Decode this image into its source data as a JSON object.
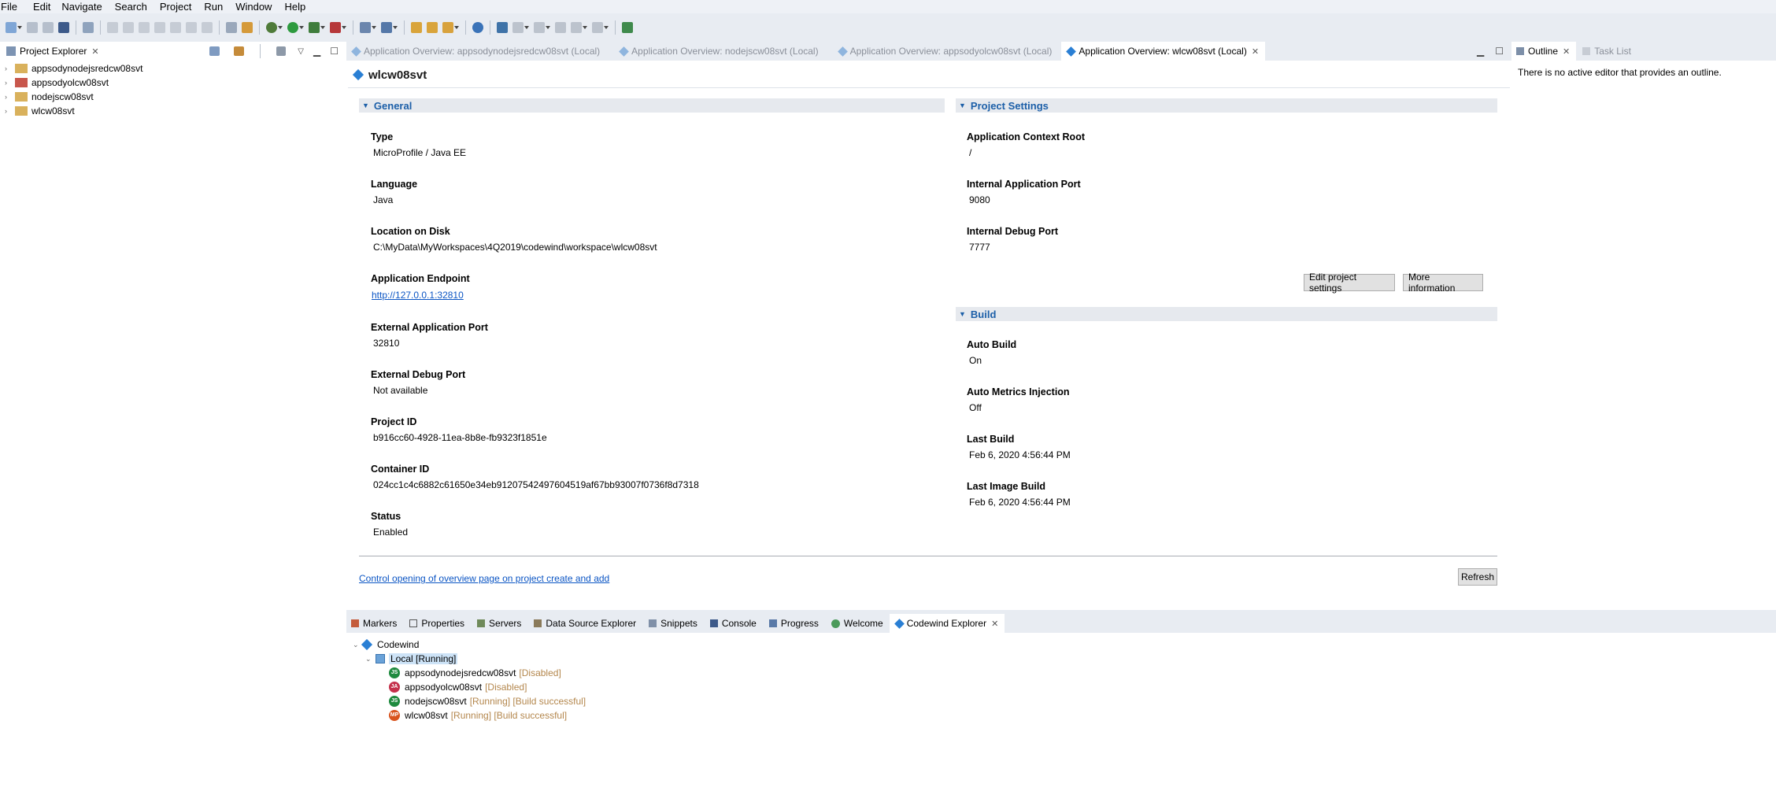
{
  "menu": [
    "File",
    "Edit",
    "Navigate",
    "Search",
    "Project",
    "Run",
    "Window",
    "Help"
  ],
  "project_explorer": {
    "title": "Project Explorer",
    "items": [
      "appsodynodejsredcw08svt",
      "appsodyolcw08svt",
      "nodejscw08svt",
      "wlcw08svt"
    ]
  },
  "editor_tabs": [
    {
      "label": "Application Overview: appsodynodejsredcw08svt (Local)",
      "active": false
    },
    {
      "label": "Application Overview: nodejscw08svt (Local)",
      "active": false
    },
    {
      "label": "Application Overview: appsodyolcw08svt (Local)",
      "active": false
    },
    {
      "label": "Application Overview: wlcw08svt (Local)",
      "active": true
    }
  ],
  "overview": {
    "title": "wlcw08svt",
    "general": {
      "header": "General",
      "fields": [
        {
          "label": "Type",
          "value": "MicroProfile / Java EE"
        },
        {
          "label": "Language",
          "value": "Java"
        },
        {
          "label": "Location on Disk",
          "value": "C:\\MyData\\MyWorkspaces\\4Q2019\\codewind\\workspace\\wlcw08svt"
        },
        {
          "label": "Application Endpoint",
          "value": "http://127.0.0.1:32810"
        },
        {
          "label": "External Application Port",
          "value": "32810"
        },
        {
          "label": "External Debug Port",
          "value": "Not available"
        },
        {
          "label": "Project ID",
          "value": "b916cc60-4928-11ea-8b8e-fb9323f1851e"
        },
        {
          "label": "Container ID",
          "value": "024cc1c4c6882c61650e34eb91207542497604519af67bb93007f0736f8d7318"
        },
        {
          "label": "Status",
          "value": "Enabled"
        }
      ]
    },
    "project_settings": {
      "header": "Project Settings",
      "fields": [
        {
          "label": "Application Context Root",
          "value": "/"
        },
        {
          "label": "Internal Application Port",
          "value": "9080"
        },
        {
          "label": "Internal Debug Port",
          "value": "7777"
        }
      ],
      "edit_button": "Edit project settings",
      "more_button": "More information"
    },
    "build": {
      "header": "Build",
      "fields": [
        {
          "label": "Auto Build",
          "value": "On"
        },
        {
          "label": "Auto Metrics Injection",
          "value": "Off"
        },
        {
          "label": "Last Build",
          "value": "Feb 6, 2020 4:56:44 PM"
        },
        {
          "label": "Last Image Build",
          "value": "Feb 6, 2020 4:56:44 PM"
        }
      ]
    },
    "footer_link": "Control opening of overview page on project create and add",
    "refresh_button": "Refresh"
  },
  "outline": {
    "tabs": [
      "Outline",
      "Task List"
    ],
    "message": "There is no active editor that provides an outline."
  },
  "bottom": {
    "tabs": [
      "Markers",
      "Properties",
      "Servers",
      "Data Source Explorer",
      "Snippets",
      "Console",
      "Progress",
      "Welcome",
      "Codewind Explorer"
    ],
    "tree": {
      "root": "Codewind",
      "connection": "Local [Running]",
      "apps": [
        {
          "name": "appsodynodejsredcw08svt",
          "status": "[Disabled]",
          "badge": "JS",
          "color": "#1e8a3e"
        },
        {
          "name": "appsodyolcw08svt",
          "status": "[Disabled]",
          "badge": "JA",
          "color": "#c4314b"
        },
        {
          "name": "nodejscw08svt",
          "status": "[Running] [Build successful]",
          "badge": "JS",
          "color": "#1e8a3e"
        },
        {
          "name": "wlcw08svt",
          "status": "[Running] [Build successful]",
          "badge": "MP",
          "color": "#d9541e"
        }
      ]
    }
  }
}
